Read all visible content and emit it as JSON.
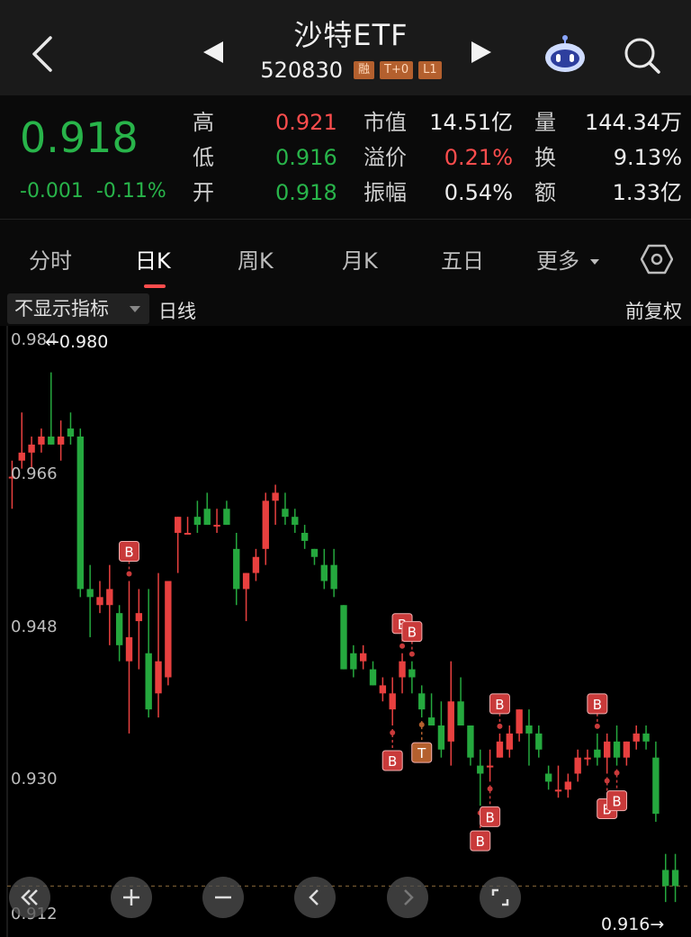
{
  "header": {
    "title": "沙特ETF",
    "code": "520830",
    "tags": [
      "融",
      "T+0",
      "L1"
    ]
  },
  "quote": {
    "price": "0.918",
    "change": "-0.001",
    "change_pct": "-0.11%",
    "high_label": "高",
    "high": "0.921",
    "low_label": "低",
    "low": "0.916",
    "open_label": "开",
    "open": "0.918",
    "mktcap_label": "市值",
    "mktcap": "14.51亿",
    "premium_label": "溢价",
    "premium": "0.21%",
    "amplitude_label": "振幅",
    "amplitude": "0.54%",
    "volume_label": "量",
    "volume": "144.34万",
    "turnover_label": "换",
    "turnover": "9.13%",
    "amount_label": "额",
    "amount": "1.33亿"
  },
  "tabs": [
    "分时",
    "日K",
    "周K",
    "月K",
    "五日",
    "更多"
  ],
  "active_tab": "日K",
  "indicator": {
    "select": "不显示指标",
    "period": "日线",
    "adjust": "前复权"
  },
  "colors": {
    "up": "#e8403f",
    "down": "#25a83e",
    "marker_b": "#c93a3a",
    "marker_t": "#b4602e"
  },
  "chart_data": {
    "type": "candlestick",
    "y_ticks": [
      "0.984",
      "0.966",
      "0.948",
      "0.930",
      "0.912"
    ],
    "ylim": [
      0.912,
      0.984
    ],
    "max_label": "0.980",
    "last_label": "0.916",
    "last_price": 0.916,
    "candles": [
      [
        0.967,
        0.969,
        0.963,
        0.967
      ],
      [
        0.969,
        0.975,
        0.968,
        0.97
      ],
      [
        0.97,
        0.972,
        0.968,
        0.971
      ],
      [
        0.971,
        0.973,
        0.97,
        0.972
      ],
      [
        0.972,
        0.98,
        0.971,
        0.971
      ],
      [
        0.971,
        0.974,
        0.969,
        0.972
      ],
      [
        0.973,
        0.975,
        0.971,
        0.972
      ],
      [
        0.972,
        0.973,
        0.952,
        0.953
      ],
      [
        0.953,
        0.956,
        0.947,
        0.952
      ],
      [
        0.951,
        0.954,
        0.95,
        0.952
      ],
      [
        0.951,
        0.956,
        0.946,
        0.953
      ],
      [
        0.95,
        0.951,
        0.944,
        0.946
      ],
      [
        0.944,
        0.954,
        0.935,
        0.947
      ],
      [
        0.949,
        0.953,
        0.943,
        0.95
      ],
      [
        0.945,
        0.953,
        0.937,
        0.938
      ],
      [
        0.94,
        0.955,
        0.937,
        0.944
      ],
      [
        0.942,
        0.954,
        0.941,
        0.954
      ],
      [
        0.96,
        0.962,
        0.955,
        0.962
      ],
      [
        0.96,
        0.962,
        0.96,
        0.96
      ],
      [
        0.962,
        0.964,
        0.96,
        0.961
      ],
      [
        0.963,
        0.965,
        0.961,
        0.961
      ],
      [
        0.961,
        0.963,
        0.96,
        0.961
      ],
      [
        0.963,
        0.964,
        0.961,
        0.961
      ],
      [
        0.958,
        0.96,
        0.951,
        0.953
      ],
      [
        0.953,
        0.955,
        0.949,
        0.955
      ],
      [
        0.955,
        0.958,
        0.954,
        0.957
      ],
      [
        0.958,
        0.965,
        0.956,
        0.964
      ],
      [
        0.964,
        0.966,
        0.961,
        0.965
      ],
      [
        0.963,
        0.965,
        0.961,
        0.962
      ],
      [
        0.962,
        0.963,
        0.96,
        0.961
      ],
      [
        0.96,
        0.961,
        0.958,
        0.959
      ],
      [
        0.958,
        0.958,
        0.956,
        0.957
      ],
      [
        0.956,
        0.958,
        0.953,
        0.954
      ],
      [
        0.956,
        0.958,
        0.952,
        0.953
      ],
      [
        0.951,
        0.951,
        0.943,
        0.943
      ],
      [
        0.945,
        0.946,
        0.942,
        0.943
      ],
      [
        0.944,
        0.946,
        0.943,
        0.945
      ],
      [
        0.943,
        0.944,
        0.941,
        0.941
      ],
      [
        0.94,
        0.942,
        0.939,
        0.941
      ],
      [
        0.938,
        0.942,
        0.936,
        0.94
      ],
      [
        0.942,
        0.945,
        0.94,
        0.944
      ],
      [
        0.943,
        0.944,
        0.94,
        0.942
      ],
      [
        0.94,
        0.941,
        0.937,
        0.938
      ],
      [
        0.937,
        0.94,
        0.936,
        0.936
      ],
      [
        0.936,
        0.939,
        0.932,
        0.933
      ],
      [
        0.934,
        0.944,
        0.931,
        0.939
      ],
      [
        0.939,
        0.942,
        0.936,
        0.936
      ],
      [
        0.936,
        0.936,
        0.931,
        0.932
      ],
      [
        0.931,
        0.933,
        0.926,
        0.93
      ],
      [
        0.931,
        0.933,
        0.929,
        0.931
      ],
      [
        0.932,
        0.935,
        0.932,
        0.934
      ],
      [
        0.933,
        0.936,
        0.932,
        0.935
      ],
      [
        0.935,
        0.938,
        0.934,
        0.938
      ],
      [
        0.936,
        0.938,
        0.931,
        0.935
      ],
      [
        0.935,
        0.936,
        0.932,
        0.933
      ],
      [
        0.93,
        0.931,
        0.928,
        0.929
      ],
      [
        0.928,
        0.931,
        0.927,
        0.928
      ],
      [
        0.928,
        0.93,
        0.927,
        0.929
      ],
      [
        0.93,
        0.933,
        0.929,
        0.932
      ],
      [
        0.932,
        0.933,
        0.931,
        0.932
      ],
      [
        0.933,
        0.935,
        0.931,
        0.932
      ],
      [
        0.932,
        0.935,
        0.93,
        0.934
      ],
      [
        0.934,
        0.936,
        0.931,
        0.932
      ],
      [
        0.932,
        0.934,
        0.931,
        0.934
      ],
      [
        0.934,
        0.936,
        0.933,
        0.935
      ],
      [
        0.935,
        0.936,
        0.933,
        0.934
      ],
      [
        0.932,
        0.934,
        0.924,
        0.925
      ],
      [
        0.918,
        0.92,
        0.914,
        0.916
      ],
      [
        0.918,
        0.92,
        0.914,
        0.916
      ]
    ],
    "markers": [
      {
        "i": 12,
        "label": "B",
        "pos": "above"
      },
      {
        "i": 40,
        "label": "B",
        "pos": "above"
      },
      {
        "i": 41,
        "label": "B",
        "pos": "above"
      },
      {
        "i": 39,
        "label": "B",
        "pos": "below"
      },
      {
        "i": 42,
        "label": "T",
        "pos": "below"
      },
      {
        "i": 48,
        "label": "B",
        "pos": "below"
      },
      {
        "i": 49,
        "label": "B",
        "pos": "below"
      },
      {
        "i": 50,
        "label": "B",
        "pos": "above"
      },
      {
        "i": 60,
        "label": "B",
        "pos": "above"
      },
      {
        "i": 61,
        "label": "B",
        "pos": "below"
      },
      {
        "i": 62,
        "label": "B",
        "pos": "below"
      }
    ]
  }
}
